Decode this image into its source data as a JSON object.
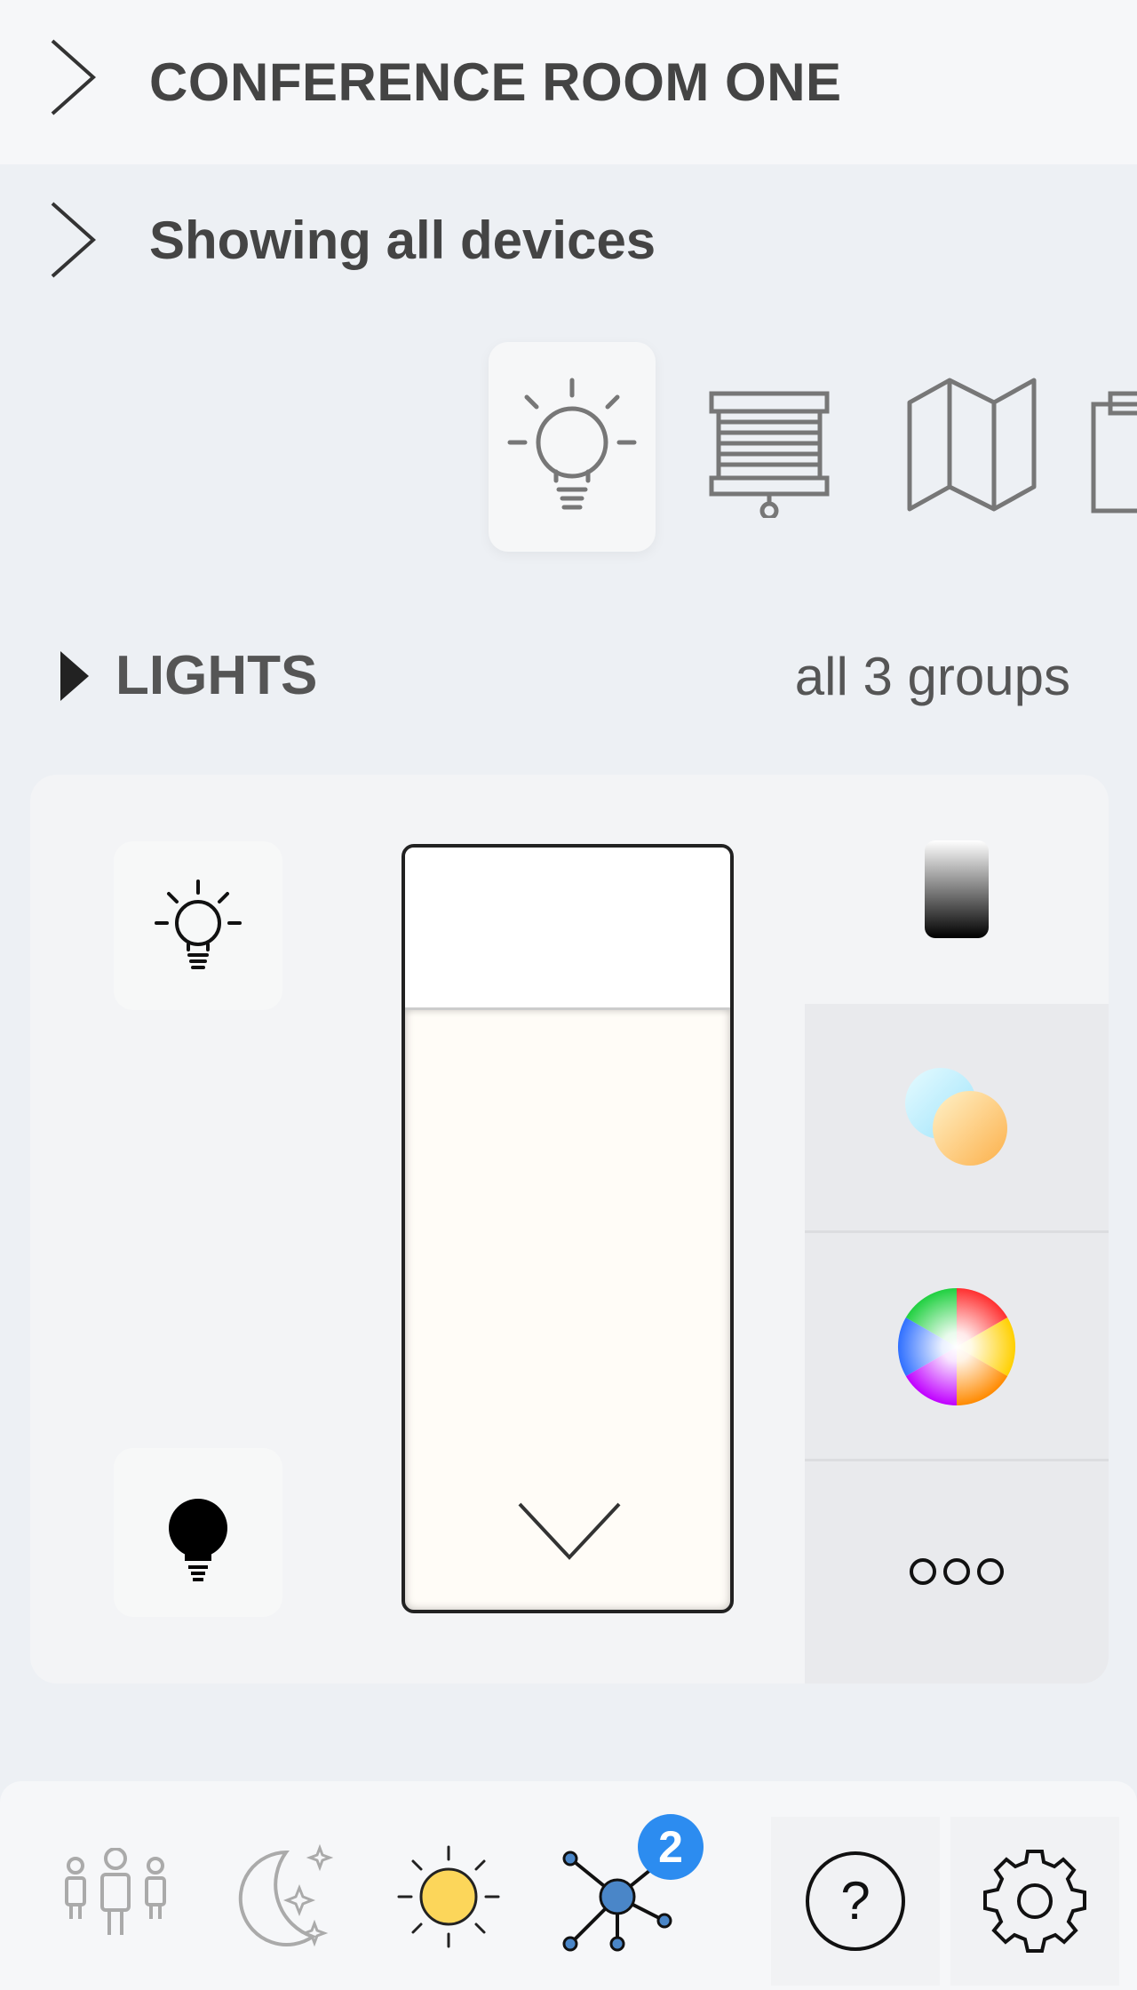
{
  "room": {
    "name": "CONFERENCE ROOM ONE"
  },
  "filter": {
    "label": "Showing all devices"
  },
  "categories": [
    {
      "name": "lights",
      "active": true
    },
    {
      "name": "projector-screen",
      "active": false
    },
    {
      "name": "map",
      "active": false
    },
    {
      "name": "clipboard",
      "active": false
    }
  ],
  "section": {
    "title": "LIGHTS",
    "count": "all 3 groups"
  },
  "light_control": {
    "level_indicator": "full",
    "modes": [
      "brightness-icon",
      "color-temperature-icon",
      "color-wheel-icon",
      "more-options-icon"
    ]
  },
  "bottom_bar": {
    "items": [
      "presence-icon",
      "night-scene-icon",
      "day-scene-icon",
      "network-icon",
      "help-icon",
      "settings-icon"
    ],
    "network_badge": "2"
  },
  "colors": {
    "accent": "#2c8cf0",
    "sun": "#fcd65a",
    "network_node": "#4a86c8"
  }
}
